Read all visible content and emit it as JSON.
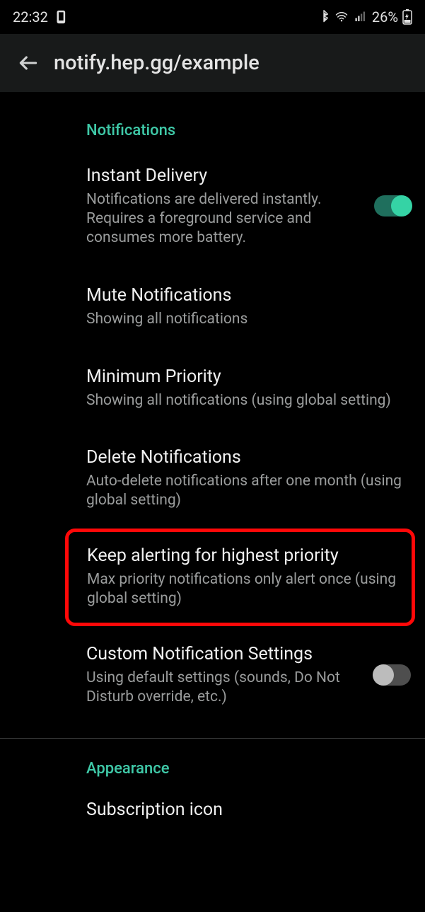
{
  "statusbar": {
    "time": "22:32",
    "battery_text": "26%"
  },
  "appbar": {
    "title": "notify.hep.gg/example"
  },
  "sections": {
    "notifications_header": "Notifications",
    "appearance_header": "Appearance"
  },
  "settings": {
    "instant_delivery": {
      "title": "Instant Delivery",
      "sub": "Notifications are delivered instantly. Requires a foreground service and consumes more battery.",
      "on": true
    },
    "mute": {
      "title": "Mute Notifications",
      "sub": "Showing all notifications"
    },
    "min_priority": {
      "title": "Minimum Priority",
      "sub": "Showing all notifications (using global setting)"
    },
    "delete": {
      "title": "Delete Notifications",
      "sub": "Auto-delete notifications after one month (using global setting)"
    },
    "keep_alerting": {
      "title": "Keep alerting for highest priority",
      "sub": "Max priority notifications only alert once (using global setting)"
    },
    "custom": {
      "title": "Custom Notification Settings",
      "sub": "Using default settings (sounds, Do Not Disturb override, etc.)",
      "on": false
    },
    "subscription_icon": {
      "title": "Subscription icon"
    }
  },
  "colors": {
    "accent": "#3fc9a8",
    "highlight": "#ff0808"
  }
}
